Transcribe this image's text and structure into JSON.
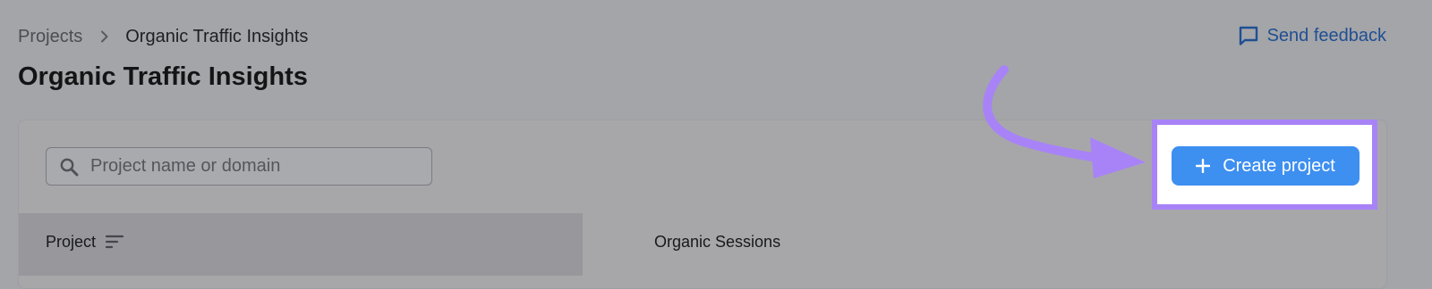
{
  "breadcrumb": {
    "parent_label": "Projects",
    "separator_icon": "chevron-right-icon",
    "current_label": "Organic Traffic Insights"
  },
  "header": {
    "title": "Organic Traffic Insights",
    "feedback_label": "Send feedback",
    "feedback_icon": "message-square-icon"
  },
  "search": {
    "placeholder": "Project name or domain",
    "value": "",
    "icon": "search-icon"
  },
  "actions": {
    "create_label": "Create project",
    "create_icon": "plus-icon"
  },
  "table": {
    "columns": [
      {
        "label": "Project",
        "sort_icon": "sort-icon"
      },
      {
        "label": "Organic Sessions"
      }
    ]
  },
  "annotation": {
    "arrow_icon": "curved-arrow-icon",
    "highlight_color": "#a883f7"
  },
  "colors": {
    "accent": "#3d8ff0",
    "link": "#1f4f93",
    "background_overlay": "#a4a5a8"
  }
}
